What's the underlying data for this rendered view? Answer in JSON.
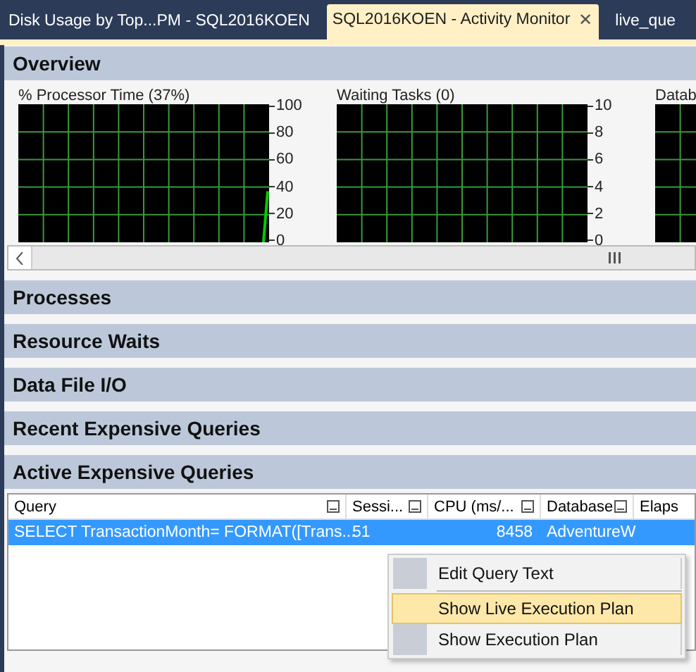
{
  "tabs": [
    {
      "label": "Disk Usage by Top...PM - SQL2016KOEN",
      "selected": false
    },
    {
      "label": "SQL2016KOEN - Activity Monitor",
      "selected": true,
      "close": "✕"
    },
    {
      "label": "live_que",
      "selected": false
    }
  ],
  "overview": {
    "title": "Overview",
    "charts": [
      {
        "title": "% Processor Time (37%)",
        "axis_labels": [
          "100",
          "80",
          "60",
          "40",
          "20",
          "0"
        ],
        "trace": true
      },
      {
        "title": "Waiting Tasks (0)",
        "axis_labels": [
          "10",
          "8",
          "6",
          "4",
          "2",
          "0"
        ],
        "trace": false
      },
      {
        "title": "Datab"
      }
    ]
  },
  "sections": [
    {
      "title": "Processes"
    },
    {
      "title": "Resource Waits"
    },
    {
      "title": "Data File I/O"
    },
    {
      "title": "Recent Expensive Queries"
    }
  ],
  "active_queries": {
    "title": "Active Expensive Queries",
    "columns": [
      "Query",
      "Sessi...",
      "CPU (ms/...",
      "Database",
      "Elaps"
    ],
    "rows": [
      {
        "selected": true,
        "cells": [
          "SELECT  TransactionMonth= FORMAT([Trans...",
          "51",
          "8458",
          "AdventureW",
          ""
        ]
      }
    ]
  },
  "context_menu": [
    {
      "label": "Edit Query Text",
      "selected": false,
      "separator_after": true
    },
    {
      "label": "Show Live Execution Plan",
      "selected": true,
      "separator_after": false
    },
    {
      "label": "Show Execution Plan",
      "selected": false,
      "separator_after": false
    }
  ]
}
